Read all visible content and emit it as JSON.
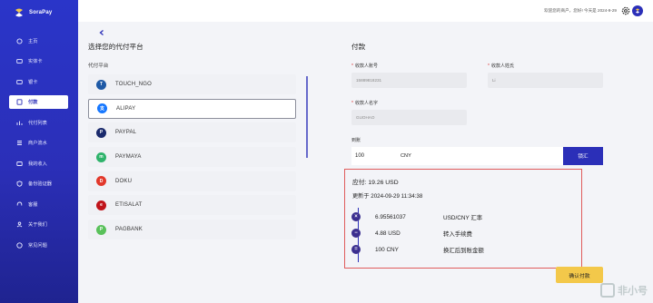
{
  "app": {
    "name": "SoraPay"
  },
  "header": {
    "welcome": "欢迎您的商户，您好! 今天是 2024-9-29"
  },
  "sidebar": {
    "items": [
      {
        "label": "主页",
        "icon": "home-icon"
      },
      {
        "label": "实体卡",
        "icon": "card-icon"
      },
      {
        "label": "银卡",
        "icon": "card-icon"
      },
      {
        "label": "付款",
        "icon": "payment-icon",
        "active": true
      },
      {
        "label": "代付列表",
        "icon": "chart-icon"
      },
      {
        "label": "商户流水",
        "icon": "ledger-icon"
      },
      {
        "label": "我的收入",
        "icon": "wallet-icon"
      },
      {
        "label": "备份验证器",
        "icon": "shield-icon"
      },
      {
        "label": "客服",
        "icon": "headset-icon"
      },
      {
        "label": "关于我们",
        "icon": "users-icon"
      },
      {
        "label": "常见问题",
        "icon": "help-icon"
      }
    ]
  },
  "left": {
    "title": "选择您的代付平台",
    "subtitle": "代付平台",
    "platforms": [
      {
        "name": "TOUCH_NGO",
        "color": "#1f5aa6",
        "glyph": "T"
      },
      {
        "name": "ALIPAY",
        "color": "#1677ff",
        "glyph": "支",
        "selected": true
      },
      {
        "name": "PAYPAL",
        "color": "#1a2a6c",
        "glyph": "P"
      },
      {
        "name": "PAYMAYA",
        "color": "#2fb36b",
        "glyph": "m"
      },
      {
        "name": "DOKU",
        "color": "#e2382b",
        "glyph": "D"
      },
      {
        "name": "ETISALAT",
        "color": "#c0141b",
        "glyph": "e"
      },
      {
        "name": "PAGBANK",
        "color": "#59c15a",
        "glyph": "P"
      }
    ]
  },
  "right": {
    "title": "付款",
    "fields": {
      "account_label": "收款人账号",
      "account_value": "15889818231",
      "name_label": "收款人姓氏",
      "name_value": "Li",
      "firstname_label": "收款人名字",
      "firstname_value": "GUOHAO"
    },
    "amount": {
      "label": "到账",
      "value": "100",
      "currency": "CNY",
      "lock_label": "锁汇"
    },
    "quote": {
      "due": "应付:   19.26 USD",
      "updated": "更新于 2024-09-29 11:34:38",
      "rows": [
        {
          "symbol": "×",
          "value": "6.95561037",
          "desc": "USD/CNY 汇率"
        },
        {
          "symbol": "−",
          "value": "4.88 USD",
          "desc": "转入手续费"
        },
        {
          "symbol": "=",
          "value": "100 CNY",
          "desc": "换汇后到账金额"
        }
      ]
    },
    "confirm_label": "确认付款"
  },
  "watermark": {
    "text": "非小号"
  },
  "colors": {
    "primary": "#2b2fb8",
    "accent": "#f3c84a",
    "highlight_border": "#e05b5b"
  }
}
